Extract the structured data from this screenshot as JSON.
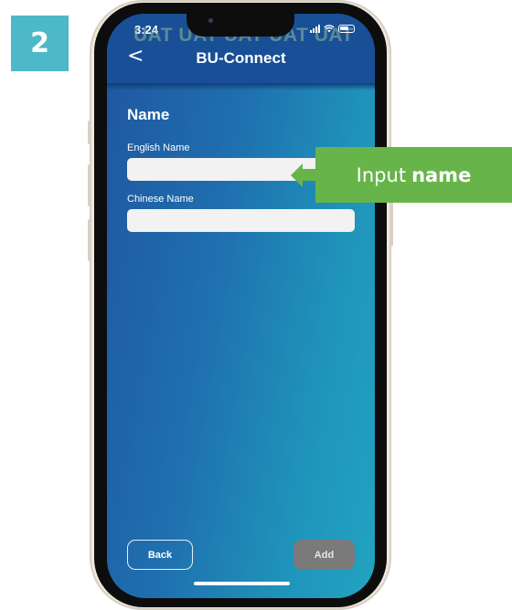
{
  "step": {
    "number": "2"
  },
  "status_bar": {
    "time": "3:24",
    "watermark": "UAT UAT UAT UAT UAT"
  },
  "header": {
    "back_glyph": "<",
    "title": "BU-Connect"
  },
  "form": {
    "section_title": "Name",
    "english_name": {
      "label": "English Name",
      "value": "",
      "placeholder": ""
    },
    "chinese_name": {
      "label": "Chinese Name",
      "value": "",
      "placeholder": ""
    }
  },
  "footer": {
    "back_label": "Back",
    "add_label": "Add"
  },
  "callout": {
    "text_prefix": "Input",
    "text_bold": "name"
  },
  "colors": {
    "badge": "#4db8c8",
    "header": "#184f97",
    "gradient_start": "#1f56a0",
    "gradient_end": "#22a3c1",
    "callout": "#67b54a",
    "add_button": "#7a7a7a"
  }
}
